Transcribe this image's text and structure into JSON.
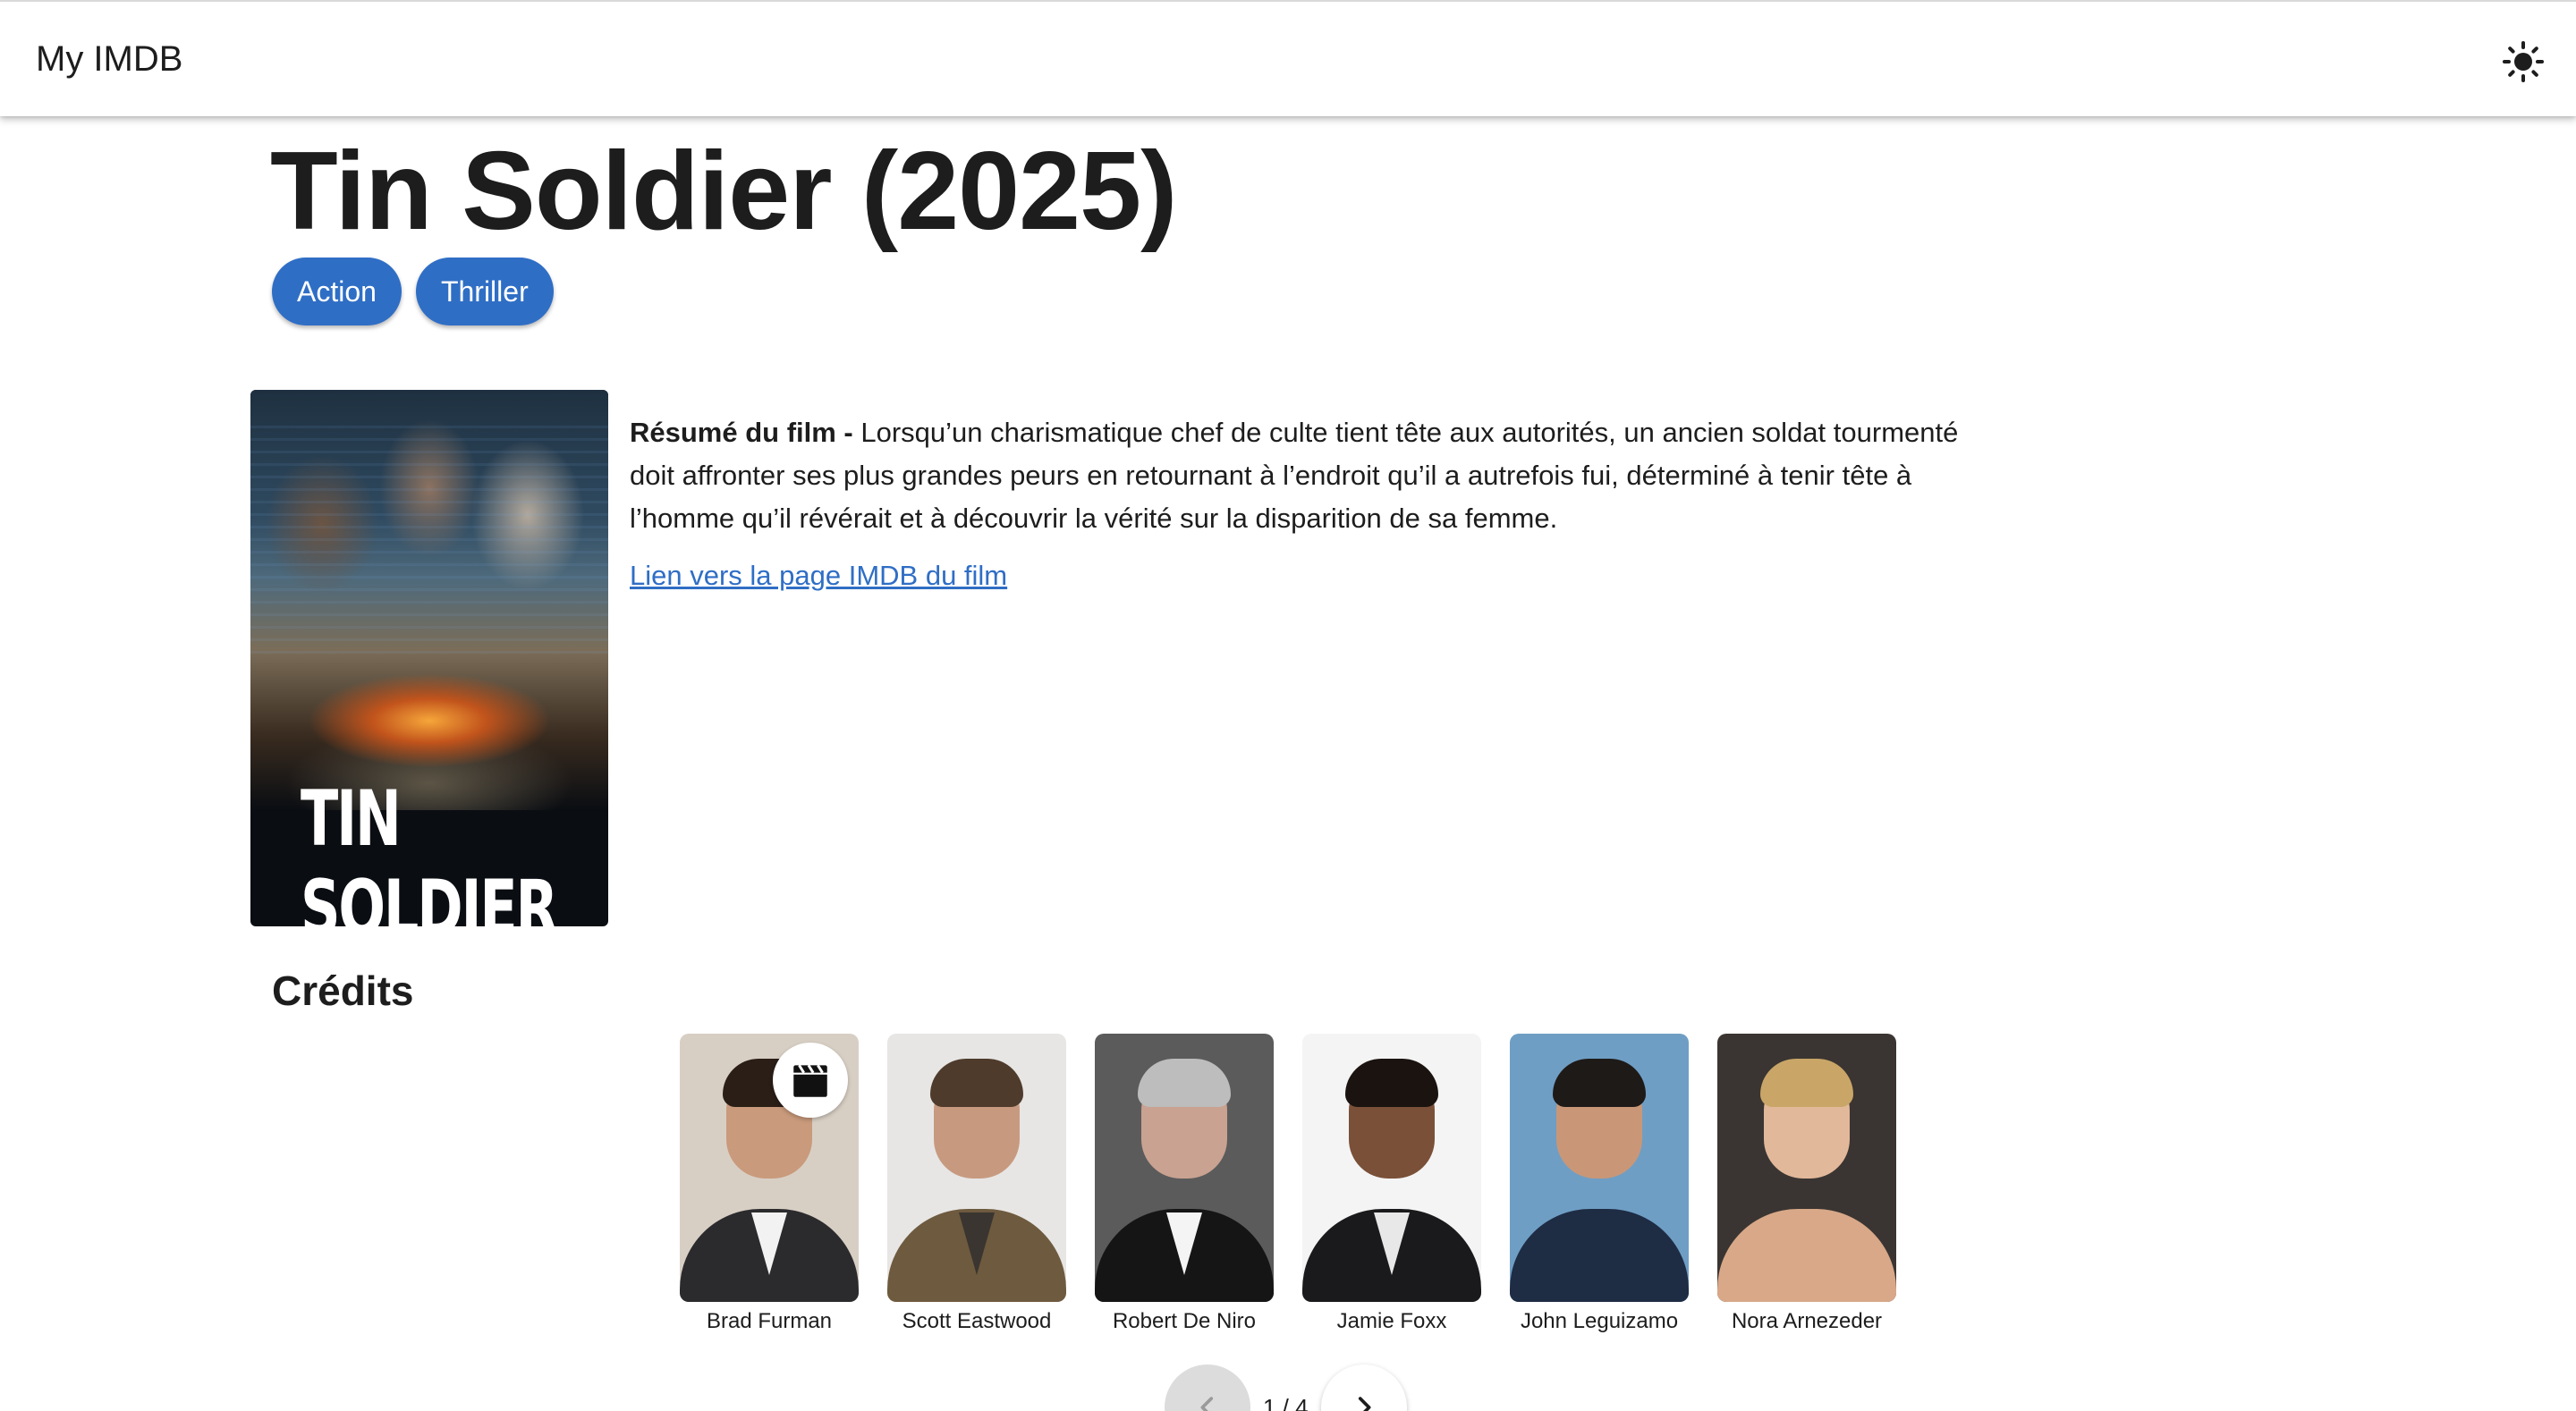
{
  "app": {
    "brand": "My IMDB",
    "theme_toggle_icon": "sun-icon"
  },
  "movie": {
    "title": "Tin Soldier (2025)",
    "genres": [
      "Action",
      "Thriller"
    ],
    "poster_title": "TIN SOLDIER",
    "summary_label": "Résumé du film -",
    "summary_text": " Lorsqu’un charismatique chef de culte tient tête aux autorités, un ancien soldat tourmenté doit affronter ses plus grandes peurs en retournant à l’endroit qu’il a autrefois fui, déterminé à tenir tête à l’homme qu’il révérait et à découvrir la vérité sur la disparition de sa femme.",
    "imdb_link_label": "Lien vers la page IMDB du film"
  },
  "credits": {
    "title": "Crédits",
    "director_badge_icon": "clapperboard-icon",
    "cast": [
      {
        "name": "Brad Furman",
        "has_director_badge": true,
        "bg": "#d8cfc4",
        "skin": "#c99a7c",
        "hair": "#2a1e17",
        "clothes": "#2b2b2e",
        "collar": "#f2f2f2"
      },
      {
        "name": "Scott Eastwood",
        "has_director_badge": false,
        "bg": "#e7e6e4",
        "skin": "#c79a80",
        "hair": "#4e3b2c",
        "clothes": "#6e5a3e",
        "collar": "#3a3530"
      },
      {
        "name": "Robert De Niro",
        "has_director_badge": false,
        "bg": "#5b5b5b",
        "skin": "#c9a291",
        "hair": "#bdbdbd",
        "clothes": "#151515",
        "collar": "#f4f4f4"
      },
      {
        "name": "Jamie Foxx",
        "has_director_badge": false,
        "bg": "#f4f4f4",
        "skin": "#7a5038",
        "hair": "#1a1310",
        "clothes": "#1a1a1c",
        "collar": "#e8e8e8"
      },
      {
        "name": "John Leguizamo",
        "has_director_badge": false,
        "bg": "#6f9ec4",
        "skin": "#c99777",
        "hair": "#1e1a18",
        "clothes": "#1e2c44",
        "collar": "#1e2c44"
      },
      {
        "name": "Nora Arnezeder",
        "has_director_badge": false,
        "bg": "#3a3532",
        "skin": "#e2b89a",
        "hair": "#c9a667",
        "clothes": "#d8a888",
        "collar": "#d8a888"
      }
    ]
  },
  "pagination": {
    "label": "1 / 4",
    "prev_icon": "chevron-left-icon",
    "next_icon": "chevron-right-icon"
  },
  "colors": {
    "accent": "#2f6ec5",
    "text": "#1d1d1d",
    "background": "#ffffff"
  }
}
